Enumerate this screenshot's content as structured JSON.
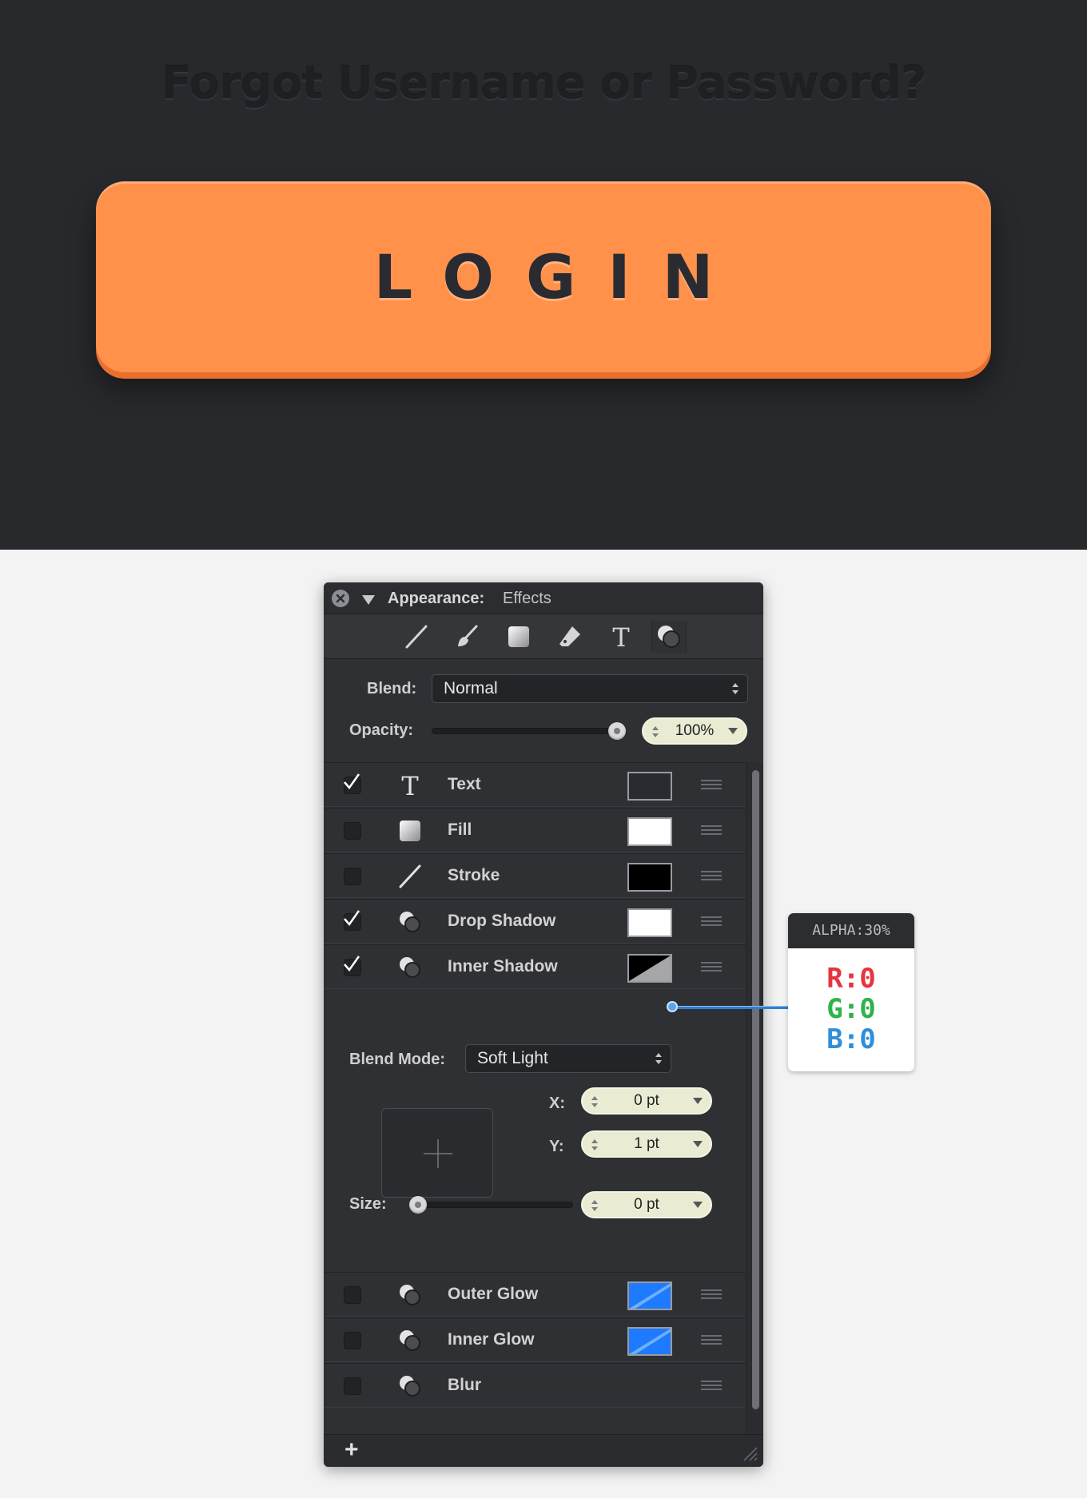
{
  "preview": {
    "heading": "Forgot Username or Password?",
    "login_label": "LOGIN",
    "button_color": "#ff914b",
    "background_color": "#28292d"
  },
  "panel": {
    "title": "Appearance:",
    "subtitle": "Effects",
    "toolbar_icons": [
      "stroke-tool-icon",
      "brush-tool-icon",
      "fill-tool-icon",
      "eraser-tool-icon",
      "text-tool-icon",
      "effects-tool-icon"
    ],
    "blend_label": "Blend:",
    "blend_value": "Normal",
    "opacity_label": "Opacity:",
    "opacity_value": "100%",
    "opacity_level": 1.0
  },
  "effects": [
    {
      "name": "Text",
      "checked": true,
      "icon": "text-icon",
      "swatch": "#2a2b2f"
    },
    {
      "name": "Fill",
      "checked": false,
      "icon": "fill-icon",
      "swatch": "#ffffff"
    },
    {
      "name": "Stroke",
      "checked": false,
      "icon": "stroke-icon",
      "swatch": "#000000"
    },
    {
      "name": "Drop Shadow",
      "checked": true,
      "icon": "shadow-icon",
      "swatch": "#ffffff"
    },
    {
      "name": "Inner Shadow",
      "checked": true,
      "icon": "shadow-icon",
      "swatch": "split-black-gray"
    },
    {
      "name": "Outer Glow",
      "checked": false,
      "icon": "glow-icon",
      "swatch": "#1e7bff"
    },
    {
      "name": "Inner Glow",
      "checked": false,
      "icon": "glow-icon",
      "swatch": "#1e7bff"
    },
    {
      "name": "Blur",
      "checked": false,
      "icon": "blur-icon",
      "swatch": null
    }
  ],
  "inner_shadow": {
    "blend_mode_label": "Blend Mode:",
    "blend_mode_value": "Soft Light",
    "x_label": "X:",
    "x_value": "0 pt",
    "y_label": "Y:",
    "y_value": "1 pt",
    "size_label": "Size:",
    "size_value": "0 pt",
    "size_level": 0
  },
  "callout": {
    "alpha": "ALPHA:30%",
    "r": "R:0",
    "g": "G:0",
    "b": "B:0",
    "r_color": "#e8343e",
    "g_color": "#2fb34a",
    "b_color": "#2f8fd8"
  },
  "footer": {
    "add_label": "+"
  }
}
